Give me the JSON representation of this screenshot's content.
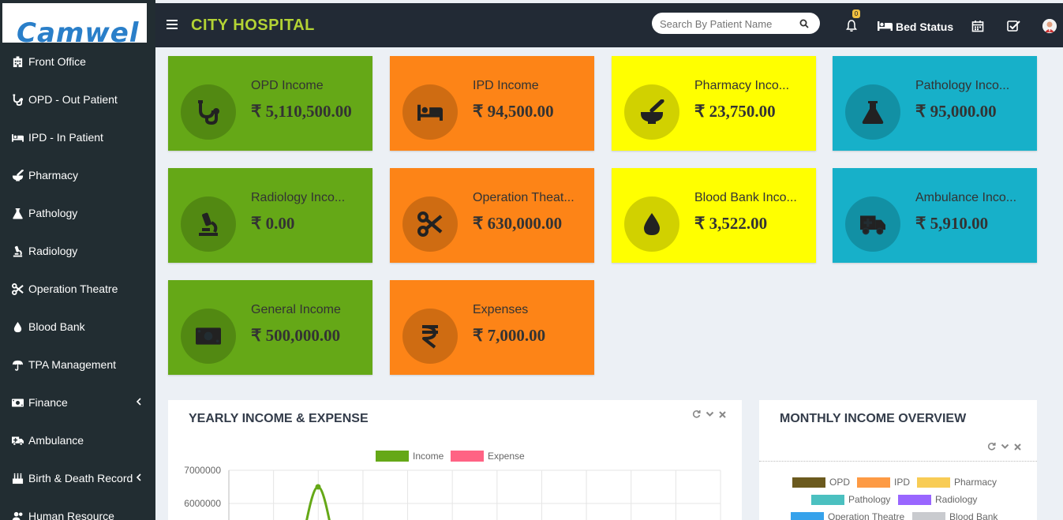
{
  "logo": {
    "text": "Camwel"
  },
  "topbar": {
    "brand": "CITY HOSPITAL",
    "search_placeholder": "Search By Patient Name",
    "notification_count": "0",
    "bed_status": "Bed Status"
  },
  "sidebar": {
    "items": [
      {
        "label": "Front Office",
        "icon": "building-icon"
      },
      {
        "label": "OPD - Out Patient",
        "icon": "stethoscope-icon"
      },
      {
        "label": "IPD - In Patient",
        "icon": "bed-icon"
      },
      {
        "label": "Pharmacy",
        "icon": "mortar-pestle-icon"
      },
      {
        "label": "Pathology",
        "icon": "flask-icon"
      },
      {
        "label": "Radiology",
        "icon": "microscope-icon"
      },
      {
        "label": "Operation Theatre",
        "icon": "scissors-icon"
      },
      {
        "label": "Blood Bank",
        "icon": "droplet-icon"
      },
      {
        "label": "TPA Management",
        "icon": "umbrella-icon"
      },
      {
        "label": "Finance",
        "icon": "money-icon",
        "has_submenu": true
      },
      {
        "label": "Ambulance",
        "icon": "ambulance-icon"
      },
      {
        "label": "Birth & Death Record",
        "icon": "birthday-cake-icon",
        "has_submenu": true
      },
      {
        "label": "Human Resource",
        "icon": "users-icon"
      }
    ]
  },
  "cards": [
    {
      "title": "OPD Income",
      "value": "₹ 5,110,500.00",
      "color": "#65a817",
      "icon": "stethoscope-icon"
    },
    {
      "title": "IPD Income",
      "value": "₹ 94,500.00",
      "color": "#fd8417",
      "icon": "bed-icon"
    },
    {
      "title": "Pharmacy Inco...",
      "value": "₹ 23,750.00",
      "color": "#ffff00",
      "icon": "mortar-pestle-icon"
    },
    {
      "title": "Pathology Inco...",
      "value": "₹ 95,000.00",
      "color": "#17b0c9",
      "icon": "flask-icon"
    },
    {
      "title": "Radiology Inco...",
      "value": "₹ 0.00",
      "color": "#65a817",
      "icon": "microscope-icon"
    },
    {
      "title": "Operation Theat...",
      "value": "₹ 630,000.00",
      "color": "#fd8417",
      "icon": "scissors-icon"
    },
    {
      "title": "Blood Bank Inco...",
      "value": "₹ 3,522.00",
      "color": "#ffff00",
      "icon": "droplet-icon"
    },
    {
      "title": "Ambulance Inco...",
      "value": "₹ 5,910.00",
      "color": "#17b0c9",
      "icon": "ambulance-icon"
    },
    {
      "title": "General Income",
      "value": "₹ 500,000.00",
      "color": "#65a817",
      "icon": "money-icon"
    },
    {
      "title": "Expenses",
      "value": "₹ 7,000.00",
      "color": "#fd8417",
      "icon": "rupee-icon"
    }
  ],
  "yearly_panel": {
    "title": "YEARLY INCOME & EXPENSE"
  },
  "monthly_panel": {
    "title": "MONTHLY INCOME OVERVIEW",
    "legend": [
      {
        "label": "OPD",
        "color": "#6b5a1e"
      },
      {
        "label": "IPD",
        "color": "#fd9a44"
      },
      {
        "label": "Pharmacy",
        "color": "#f8cc55"
      },
      {
        "label": "Pathology",
        "color": "#4bc0c0"
      },
      {
        "label": "Radiology",
        "color": "#9966ff"
      },
      {
        "label": "Operation Theatre",
        "color": "#36a2eb"
      },
      {
        "label": "Blood Bank",
        "color": "#c9cbcf"
      }
    ]
  },
  "chart_data": {
    "type": "line",
    "title": "",
    "legend": [
      {
        "name": "Income",
        "color": "#65a817"
      },
      {
        "name": "Expense",
        "color": "#ff6384"
      }
    ],
    "y_ticks": [
      7000000,
      6000000
    ],
    "ylim_visible": [
      5500000,
      7000000
    ],
    "series": [
      {
        "name": "Income",
        "color": "#65a817",
        "peak_value": 6500000
      }
    ]
  }
}
